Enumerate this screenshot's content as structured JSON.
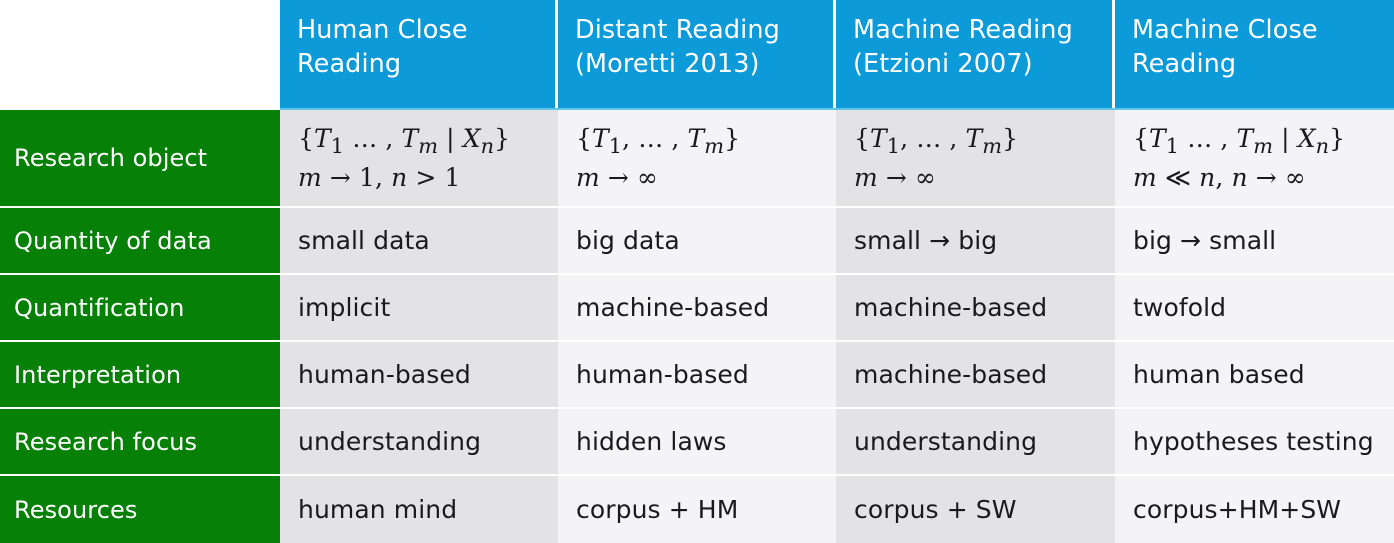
{
  "colors": {
    "header_blue": "#0c9ad9",
    "header_rule": "#5fc3ea",
    "label_green": "#068006",
    "cell_gray_odd": "#e3e3e5",
    "cell_gray_even": "#f4f4f6",
    "text_dark": "#1a1a1a",
    "text_light": "#ffffff"
  },
  "table": {
    "corner_label": "",
    "columns": [
      {
        "id": "human-close-reading",
        "label": "Human Close\nReading"
      },
      {
        "id": "distant-reading",
        "label": "Distant Reading\n(Moretti 2013)"
      },
      {
        "id": "machine-reading",
        "label": "Machine Reading\n(Etzioni 2007)"
      },
      {
        "id": "machine-close-reading",
        "label": "Machine Close\nReading"
      }
    ],
    "rows": [
      {
        "id": "research-object",
        "label": "Research object",
        "cells": [
          "{T₁ … , T_m | X_n}\nm → 1, n > 1",
          "{T₁, … , T_m}\nm → ∞",
          "{T₁, … , T_m}\nm → ∞",
          "{T₁ … , T_m | X_n}\nm ≪ n, n → ∞"
        ],
        "cells_plain": [
          "{T1 ..., Tm | Xn} m -> 1, n > 1",
          "{T1, ..., Tm} m -> infinity",
          "{T1, ..., Tm} m -> infinity",
          "{T1 ..., Tm | Xn} m << n, n -> infinity"
        ]
      },
      {
        "id": "quantity-of-data",
        "label": "Quantity of data",
        "cells": [
          "small data",
          "big data",
          "small → big",
          "big → small"
        ]
      },
      {
        "id": "quantification",
        "label": "Quantification",
        "cells": [
          "implicit",
          "machine-based",
          "machine-based",
          "twofold"
        ]
      },
      {
        "id": "interpretation",
        "label": "Interpretation",
        "cells": [
          "human-based",
          "human-based",
          "machine-based",
          "human based"
        ]
      },
      {
        "id": "research-focus",
        "label": "Research focus",
        "cells": [
          "understanding",
          "hidden laws",
          "understanding",
          "hypotheses testing"
        ]
      },
      {
        "id": "resources",
        "label": "Resources",
        "cells": [
          "human mind",
          "corpus + HM",
          "corpus + SW",
          "corpus+HM+SW"
        ]
      }
    ]
  }
}
